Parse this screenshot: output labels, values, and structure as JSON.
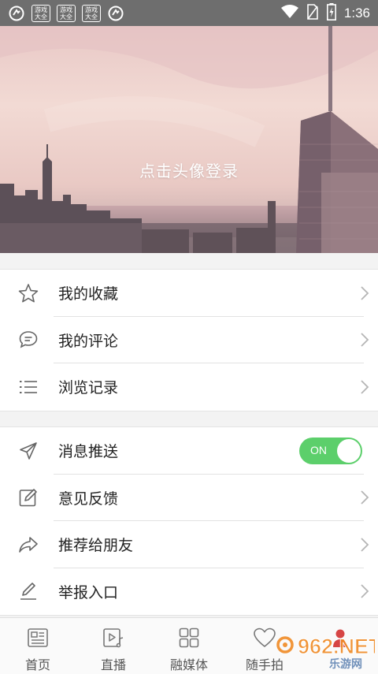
{
  "status_bar": {
    "app_badges": [
      "游戏\n大全",
      "游戏\n大全",
      "游戏\n大全"
    ],
    "time": "1:36"
  },
  "hero": {
    "login_prompt": "点击头像登录"
  },
  "menu_group_1": [
    {
      "label": "我的收藏",
      "icon": "star-icon"
    },
    {
      "label": "我的评论",
      "icon": "comment-icon"
    },
    {
      "label": "浏览记录",
      "icon": "list-icon"
    }
  ],
  "menu_group_2": [
    {
      "label": "消息推送",
      "icon": "send-icon",
      "toggle": "ON"
    },
    {
      "label": "意见反馈",
      "icon": "edit-icon"
    },
    {
      "label": "推荐给朋友",
      "icon": "share-icon"
    },
    {
      "label": "举报入口",
      "icon": "pencil-icon"
    }
  ],
  "bottom_nav": [
    {
      "label": "首页",
      "icon": "news-icon"
    },
    {
      "label": "直播",
      "icon": "live-icon"
    },
    {
      "label": "融媒体",
      "icon": "grid-icon"
    },
    {
      "label": "随手拍",
      "icon": "heart-icon"
    },
    {
      "label": "",
      "icon": "profile-icon"
    }
  ],
  "watermark": {
    "text": "962.NET",
    "sub": "乐游网"
  },
  "colors": {
    "toggle_on": "#5ccf6b",
    "status_bar": "#6e6e6e",
    "watermark_orange": "#f08a24"
  }
}
